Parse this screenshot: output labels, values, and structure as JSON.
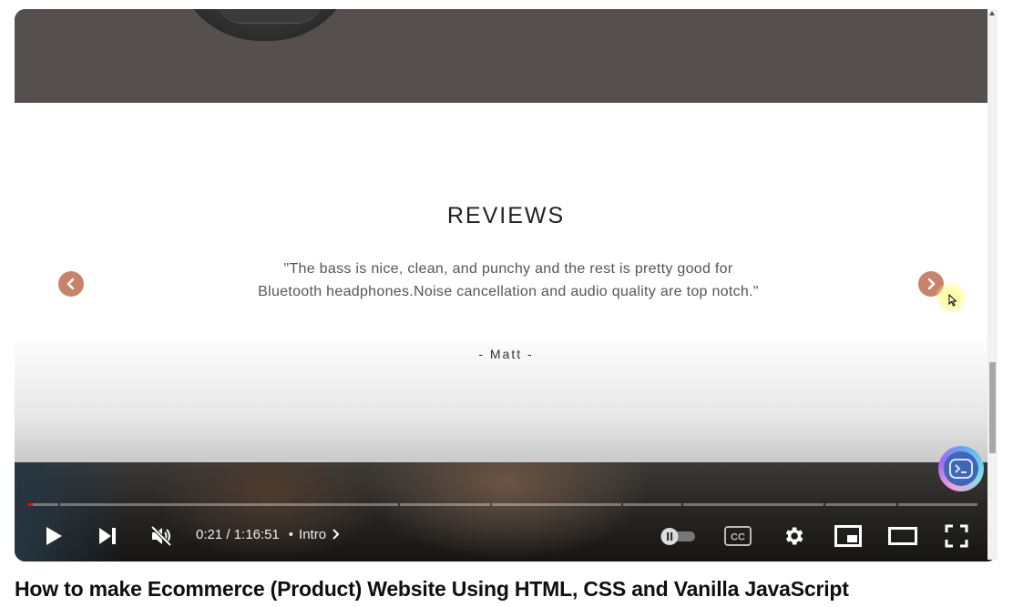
{
  "website": {
    "section_title": "REVIEWS",
    "review_text": "\"The bass is nice, clean, and punchy and the rest is pretty good for Bluetooth headphones.Noise cancellation and audio quality are top notch.\"",
    "review_author": "- Matt -",
    "accent_color": "#c8836d"
  },
  "player": {
    "time_current": "0:21",
    "time_separator": " / ",
    "time_total": "1:16:51",
    "chapter_bullet": "•",
    "chapter_label": "Intro",
    "progress_played_fraction": 0.006,
    "muted": true,
    "autoplay_on": false,
    "icons": [
      "play-icon",
      "next-icon",
      "mute-icon",
      "autoplay-toggle-icon",
      "captions-icon",
      "settings-icon",
      "miniplayer-icon",
      "theater-mode-icon",
      "fullscreen-icon"
    ],
    "captions_label": "CC"
  },
  "video": {
    "title": "How to make Ecommerce (Product) Website Using HTML, CSS and Vanilla JavaScript"
  }
}
